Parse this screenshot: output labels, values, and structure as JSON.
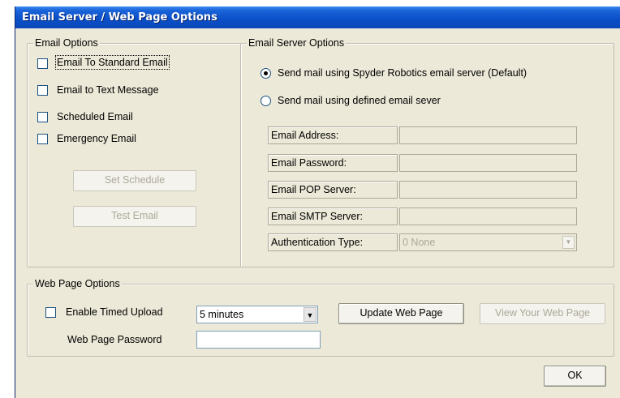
{
  "title": "Email Server / Web Page Options",
  "email_options": {
    "legend": "Email Options",
    "items": [
      {
        "label": "Email To Standard Email",
        "checked": false
      },
      {
        "label": "Email to Text Message",
        "checked": false
      },
      {
        "label": "Scheduled Email",
        "checked": false
      },
      {
        "label": "Emergency Email",
        "checked": false
      }
    ],
    "set_schedule": "Set Schedule",
    "test_email": "Test Email"
  },
  "email_server_options": {
    "legend": "Email Server Options",
    "radio_default": "Send mail using Spyder Robotics email server  (Default)",
    "radio_defined": "Send mail using defined email sever",
    "selected": "default",
    "fields": {
      "address_label": "Email Address:",
      "address_value": "",
      "password_label": "Email Password:",
      "password_value": "",
      "pop_label": "Email POP Server:",
      "pop_value": "",
      "smtp_label": "Email SMTP Server:",
      "smtp_value": "",
      "auth_label": "Authentication Type:",
      "auth_value": "0  None"
    }
  },
  "web_page_options": {
    "legend": "Web Page Options",
    "enable_timed_upload": "Enable Timed Upload",
    "interval_value": "5 minutes",
    "update_button": "Update Web Page",
    "view_button": "View Your Web Page",
    "password_label": "Web Page Password",
    "password_value": ""
  },
  "ok_button": "OK"
}
